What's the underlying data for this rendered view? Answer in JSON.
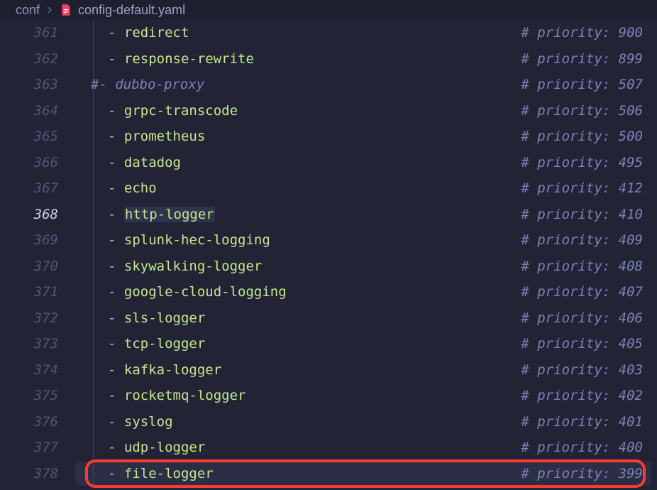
{
  "breadcrumb": {
    "folder": "conf",
    "filename": "config-default.yaml"
  },
  "activeLineNumber": "368",
  "lines": [
    {
      "num": "361",
      "type": "item",
      "name": "redirect",
      "priority": "900"
    },
    {
      "num": "362",
      "type": "item",
      "name": "response-rewrite",
      "priority": "899"
    },
    {
      "num": "363",
      "type": "commented",
      "name": "dubbo-proxy",
      "priority": "507"
    },
    {
      "num": "364",
      "type": "item",
      "name": "grpc-transcode",
      "priority": "506"
    },
    {
      "num": "365",
      "type": "item",
      "name": "prometheus",
      "priority": "500"
    },
    {
      "num": "366",
      "type": "item",
      "name": "datadog",
      "priority": "495"
    },
    {
      "num": "367",
      "type": "item",
      "name": "echo",
      "priority": "412"
    },
    {
      "num": "368",
      "type": "item",
      "name": "http-logger",
      "priority": "410",
      "highlighted": true,
      "active": true
    },
    {
      "num": "369",
      "type": "item",
      "name": "splunk-hec-logging",
      "priority": "409"
    },
    {
      "num": "370",
      "type": "item",
      "name": "skywalking-logger",
      "priority": "408"
    },
    {
      "num": "371",
      "type": "item",
      "name": "google-cloud-logging",
      "priority": "407"
    },
    {
      "num": "372",
      "type": "item",
      "name": "sls-logger",
      "priority": "406"
    },
    {
      "num": "373",
      "type": "item",
      "name": "tcp-logger",
      "priority": "405"
    },
    {
      "num": "374",
      "type": "item",
      "name": "kafka-logger",
      "priority": "403"
    },
    {
      "num": "375",
      "type": "item",
      "name": "rocketmq-logger",
      "priority": "402"
    },
    {
      "num": "376",
      "type": "item",
      "name": "syslog",
      "priority": "401"
    },
    {
      "num": "377",
      "type": "item",
      "name": "udp-logger",
      "priority": "400"
    },
    {
      "num": "378",
      "type": "item",
      "name": "file-logger",
      "priority": "399",
      "annotated": true
    }
  ],
  "labels": {
    "priorityPrefix": "# priority: ",
    "commentedDashPrefix": "#- "
  }
}
